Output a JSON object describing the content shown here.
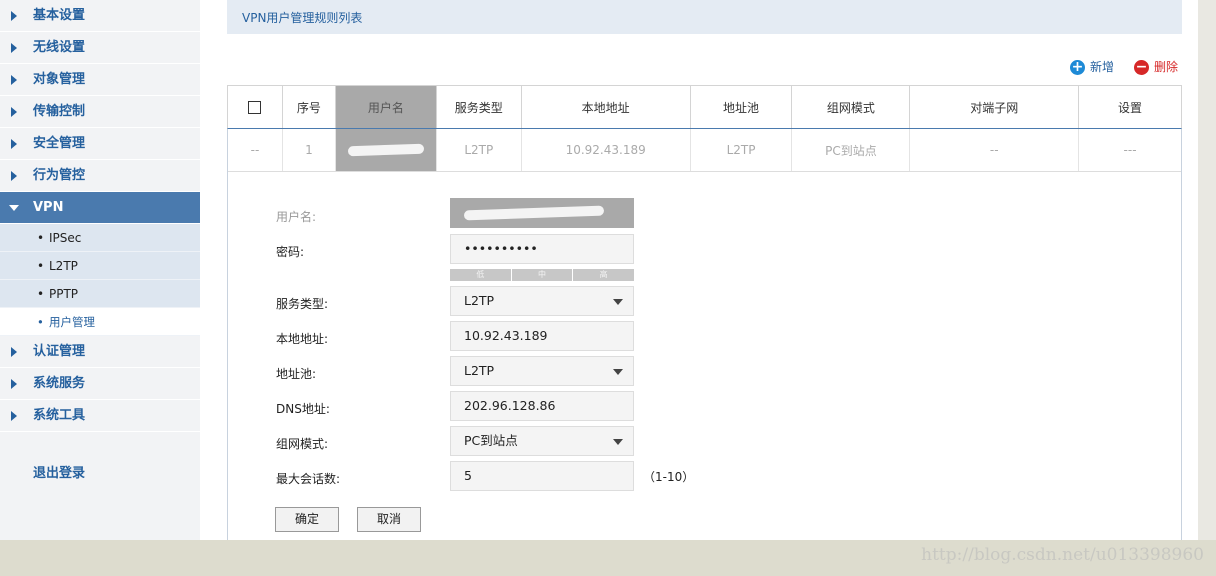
{
  "sidebar": {
    "items": [
      {
        "label": "基本设置"
      },
      {
        "label": "无线设置"
      },
      {
        "label": "对象管理"
      },
      {
        "label": "传输控制"
      },
      {
        "label": "安全管理"
      },
      {
        "label": "行为管控"
      },
      {
        "label": "VPN",
        "expanded": true
      },
      {
        "label": "认证管理"
      },
      {
        "label": "系统服务"
      },
      {
        "label": "系统工具"
      }
    ],
    "vpn_sub_items": [
      {
        "label": "IPSec"
      },
      {
        "label": "L2TP"
      },
      {
        "label": "PPTP"
      },
      {
        "label": "用户管理",
        "selected": true
      }
    ],
    "logout": "退出登录"
  },
  "panel": {
    "title": "VPN用户管理规则列表"
  },
  "actions": {
    "add": "新增",
    "delete": "删除"
  },
  "table": {
    "headers": [
      "序号",
      "用户名",
      "服务类型",
      "本地地址",
      "地址池",
      "组网模式",
      "对端子网",
      "设置"
    ],
    "rows": [
      {
        "check": "--",
        "index": "1",
        "username": "",
        "service": "L2TP",
        "local": "10.92.43.189",
        "pool": "L2TP",
        "mode": "PC到站点",
        "peer": "--",
        "settings": "---"
      }
    ]
  },
  "form": {
    "username_label": "用户名:",
    "password_label": "密码:",
    "password_value": "••••••••••",
    "strength": [
      "低",
      "中",
      "高"
    ],
    "service_label": "服务类型:",
    "service_value": "L2TP",
    "local_label": "本地地址:",
    "local_value": "10.92.43.189",
    "pool_label": "地址池:",
    "pool_value": "L2TP",
    "dns_label": "DNS地址:",
    "dns_value": "202.96.128.86",
    "mode_label": "组网模式:",
    "mode_value": "PC到站点",
    "max_sessions_label": "最大会话数:",
    "max_sessions_value": "5",
    "max_sessions_hint": "（1-10）",
    "ok": "确定",
    "cancel": "取消"
  },
  "watermark": "http://blog.csdn.net/u013398960",
  "colors": {
    "accent": "#25609e",
    "active_nav": "#4a7aae",
    "delete": "#d62828",
    "add": "#1e8ad6"
  }
}
